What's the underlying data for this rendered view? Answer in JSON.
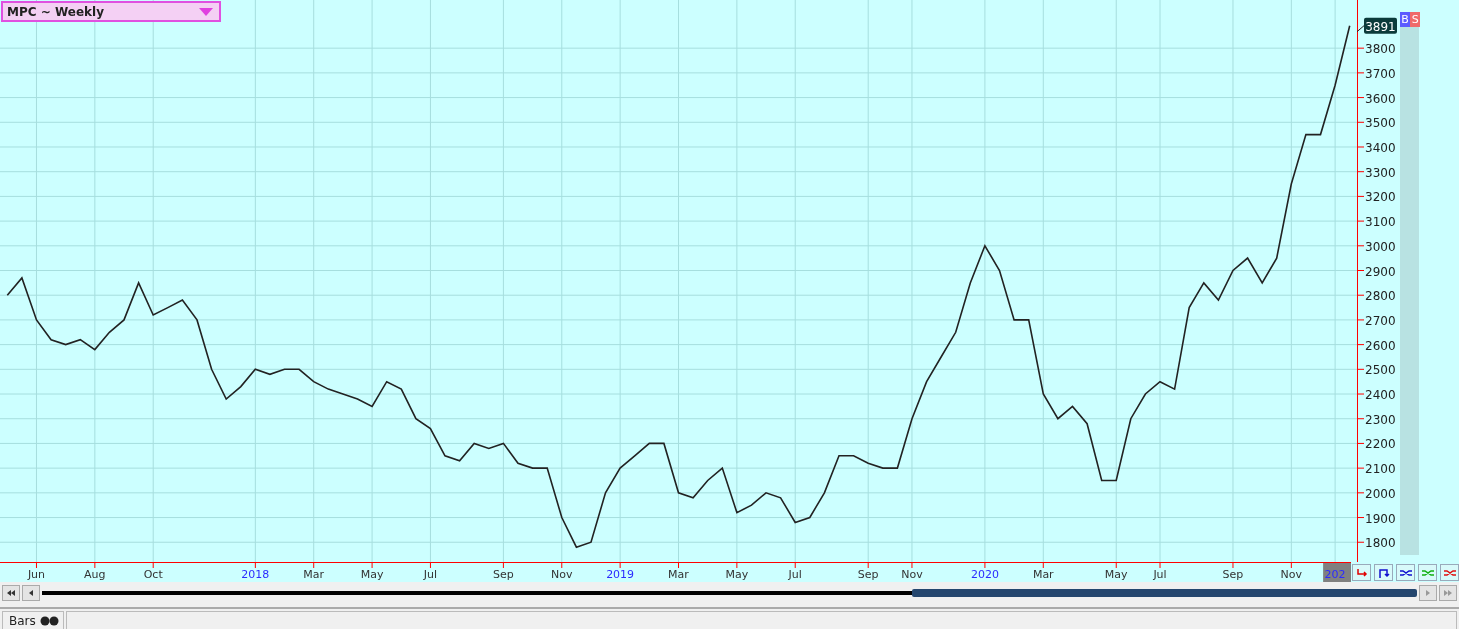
{
  "chart": {
    "symbol_selector": "MPC ~ Weekly",
    "price_label": "3891",
    "chart_data": {
      "type": "line",
      "grid": true,
      "ylim": [
        1720,
        3995
      ],
      "yticks": [
        1800,
        1900,
        2000,
        2100,
        2200,
        2300,
        2400,
        2500,
        2600,
        2700,
        2800,
        2900,
        3000,
        3100,
        3200,
        3300,
        3400,
        3500,
        3600,
        3700,
        3800
      ],
      "categories": [
        null,
        null,
        "Jun",
        null,
        null,
        null,
        "Aug",
        null,
        null,
        null,
        "Oct",
        null,
        null,
        null,
        null,
        null,
        null,
        "2018",
        null,
        null,
        null,
        "Mar",
        null,
        null,
        null,
        "May",
        null,
        null,
        null,
        "Jul",
        null,
        null,
        null,
        null,
        "Sep",
        null,
        null,
        null,
        "Nov",
        null,
        null,
        null,
        "2019",
        null,
        null,
        null,
        "Mar",
        null,
        null,
        null,
        "May",
        null,
        null,
        null,
        "Jul",
        null,
        null,
        null,
        null,
        "Sep",
        null,
        null,
        "Nov",
        null,
        null,
        null,
        null,
        "2020",
        null,
        null,
        null,
        "Mar",
        null,
        null,
        null,
        null,
        "May",
        null,
        null,
        "Jul",
        null,
        null,
        null,
        null,
        "Sep",
        null,
        null,
        null,
        "Nov",
        null,
        null,
        "202",
        null
      ],
      "series": [
        {
          "color": "#222222",
          "values": [
            2800,
            2870,
            2700,
            2620,
            2600,
            2620,
            2580,
            2650,
            2700,
            2850,
            2720,
            2750,
            2780,
            2700,
            2500,
            2380,
            2430,
            2500,
            2480,
            2500,
            2500,
            2450,
            2420,
            2400,
            2380,
            2350,
            2450,
            2420,
            2300,
            2260,
            2150,
            2130,
            2200,
            2180,
            2200,
            2120,
            2100,
            2100,
            1900,
            1780,
            1800,
            2000,
            2100,
            2150,
            2200,
            2200,
            2000,
            1980,
            2050,
            2100,
            1920,
            1950,
            2000,
            1980,
            1880,
            1900,
            2000,
            2150,
            2150,
            2120,
            2100,
            2100,
            2300,
            2450,
            2550,
            2650,
            2850,
            3000,
            2900,
            2700,
            2700,
            2400,
            2300,
            2350,
            2280,
            2050,
            2050,
            2300,
            2400,
            2450,
            2420,
            2750,
            2850,
            2780,
            2900,
            2950,
            2850,
            2950,
            3250,
            3450,
            3450,
            3650,
            3891
          ]
        }
      ]
    }
  },
  "badges": [
    {
      "label": "B",
      "color": "#5b5bff"
    },
    {
      "label": "S",
      "color": "#ef6a6a"
    }
  ],
  "status_bar": {
    "tab": "Bars"
  }
}
